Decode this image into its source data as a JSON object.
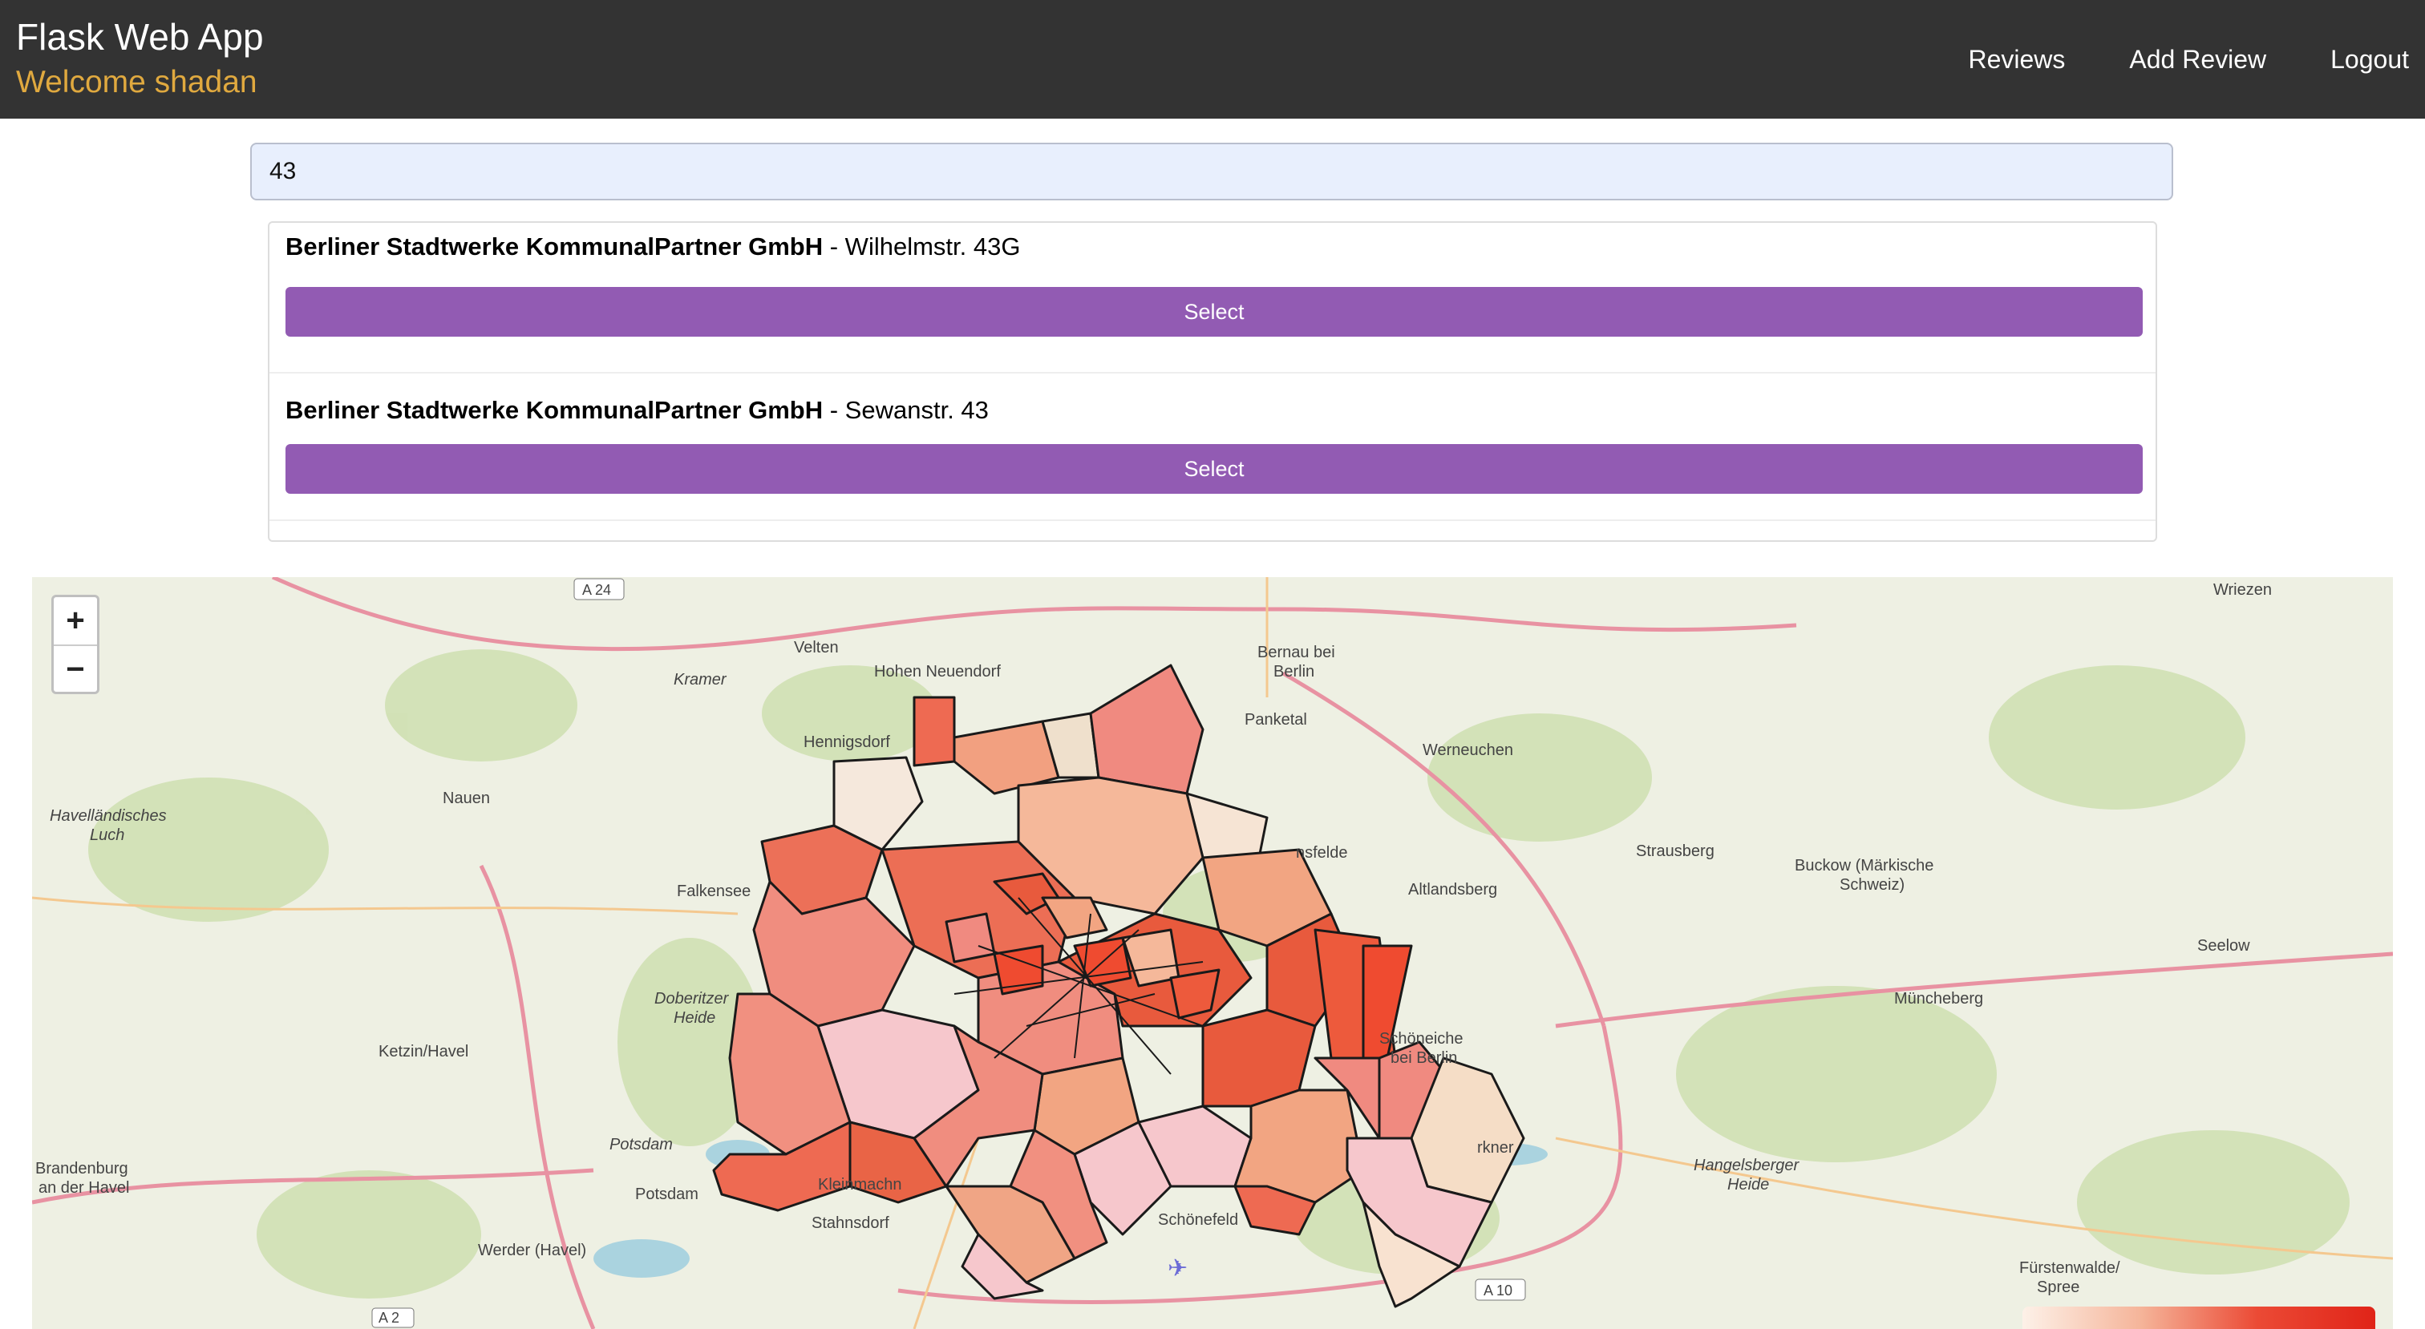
{
  "header": {
    "app_title": "Flask Web App",
    "welcome": "Welcome shadan",
    "nav": [
      {
        "label": "Reviews"
      },
      {
        "label": "Add Review"
      },
      {
        "label": "Logout"
      }
    ]
  },
  "search": {
    "value": "43"
  },
  "results": [
    {
      "name": "Berliner Stadtwerke KommunalPartner GmbH",
      "address": "- Wilhelmstr. 43G",
      "button": "Select"
    },
    {
      "name": "Berliner Stadtwerke KommunalPartner GmbH",
      "address": "- Sewanstr. 43",
      "button": "Select"
    }
  ],
  "map": {
    "zoom_in": "+",
    "zoom_out": "−",
    "places": {
      "velten": "Velten",
      "hohen_neuendorf": "Hohen Neuendorf",
      "bernau": "Bernau bei",
      "bernau2": "Berlin",
      "panketal": "Panketal",
      "wriezen": "Wriezen",
      "hennigsdorf": "Hennigsdorf",
      "kramer": "Kramer",
      "nauen": "Nauen",
      "havel1": "Havelländisches",
      "havel2": "Luch",
      "werneuchen": "Werneuchen",
      "strausberg": "Strausberg",
      "buckow1": "Buckow (Märkische",
      "buckow2": "Schweiz)",
      "falkensee": "Falkensee",
      "altlandsberg": "Altlandsberg",
      "ahrensfelde": "nsfelde",
      "seelow": "Seelow",
      "doberitzer1": "Doberitzer",
      "doberitzer2": "Heide",
      "muncheberg": "Müncheberg",
      "schoneiche1": "Schöneiche",
      "schoneiche2": "bei Berlin",
      "ketzin": "Ketzin/Havel",
      "potsdam_label": "Potsdam",
      "potsdam": "Potsdam",
      "brandenburg1": "Brandenburg",
      "brandenburg2": "an der Havel",
      "kleinmachnow": "Kleinmachn",
      "stahnsdorf": "Stahnsdorf",
      "schonefeld": "Schönefeld",
      "erkner": "rkner",
      "hangelsberger1": "Hangelsberger",
      "hangelsberger2": "Heide",
      "werder": "Werder (Havel)",
      "furstenwalde1": "Fürstenwalde/",
      "furstenwalde2": "Spree"
    },
    "roads": {
      "a24": "A 24",
      "a10": "A 10",
      "a2": "A 2"
    }
  },
  "colors": {
    "header_bg": "#333333",
    "welcome": "#e0a93f",
    "select_button": "#925bb3",
    "search_bg": "#e8effd"
  }
}
